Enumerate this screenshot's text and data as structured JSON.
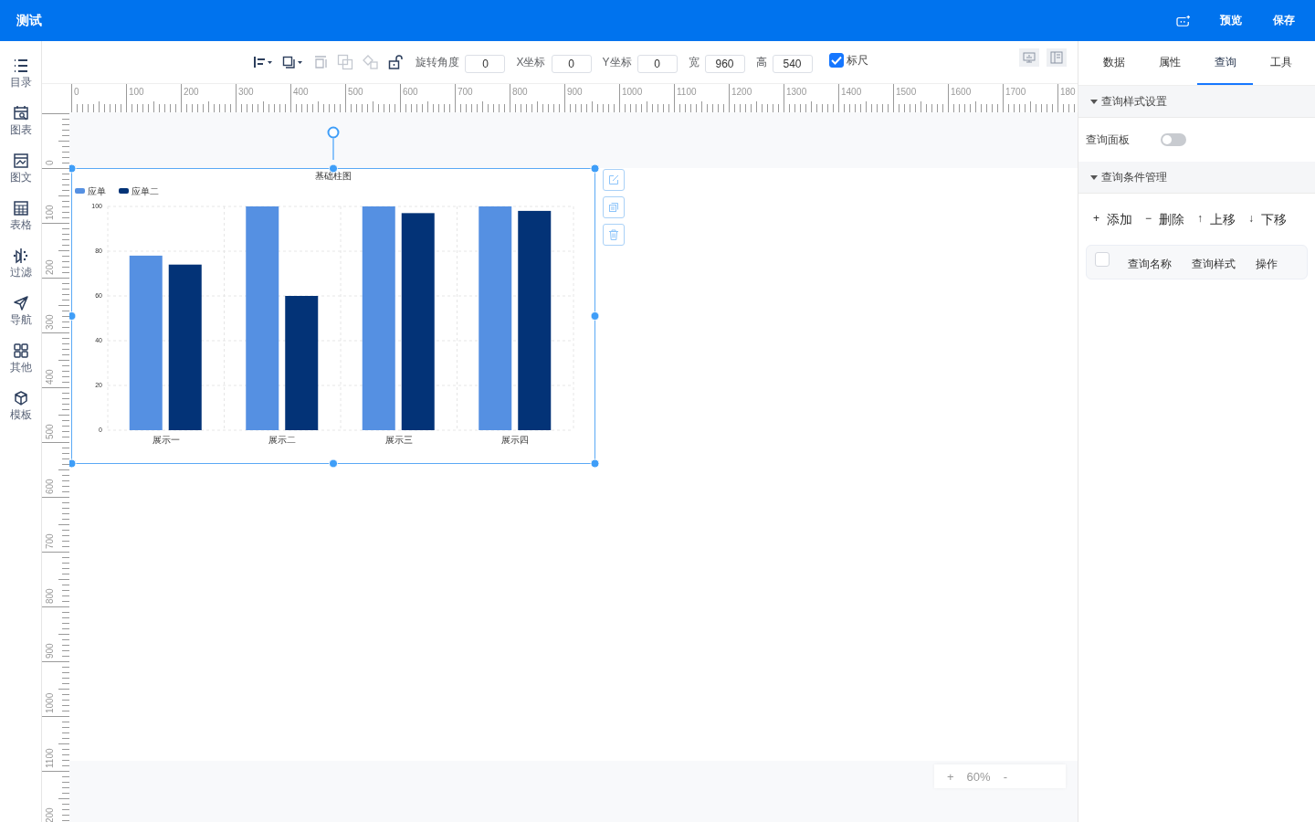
{
  "header": {
    "title": "测试",
    "actions": [
      "预览",
      "保存"
    ]
  },
  "sidebar": {
    "items": [
      {
        "label": "目录"
      },
      {
        "label": "图表"
      },
      {
        "label": "图文"
      },
      {
        "label": "表格"
      },
      {
        "label": "过滤"
      },
      {
        "label": "导航"
      },
      {
        "label": "其他"
      },
      {
        "label": "模板"
      }
    ]
  },
  "toolbar": {
    "fields": [
      {
        "label": "旋转角度",
        "value": "0"
      },
      {
        "label": "X坐标",
        "value": "0"
      },
      {
        "label": "Y坐标",
        "value": "0"
      },
      {
        "label": "宽",
        "value": "960"
      },
      {
        "label": "高",
        "value": "540"
      }
    ],
    "ruler_toggle": {
      "label": "标尺",
      "checked": true
    }
  },
  "rulers": {
    "x_labels": [
      "0",
      "100",
      "200",
      "300",
      "400",
      "500",
      "600",
      "700",
      "800",
      "900",
      "1000",
      "1100",
      "1200",
      "1300",
      "1400",
      "1500",
      "1600",
      "1700",
      "180"
    ],
    "y_labels": [
      "0",
      "100",
      "200",
      "300",
      "400",
      "500",
      "600",
      "700",
      "800",
      "900",
      "1000",
      "1100",
      "200"
    ]
  },
  "canvas": {
    "chart": {
      "selected": true,
      "chart_data": {
        "type": "bar",
        "title": "基础柱图",
        "categories": [
          "展示一",
          "展示二",
          "展示三",
          "展示四"
        ],
        "series": [
          {
            "name": "应单",
            "color": "#5590e2",
            "values": [
              78,
              100,
              100,
              100
            ]
          },
          {
            "name": "应单二",
            "color": "#033377",
            "values": [
              74,
              60,
              97,
              98
            ]
          }
        ],
        "ylim": [
          0,
          100
        ],
        "yticks": [
          {
            "value": 0,
            "label": "0"
          },
          {
            "value": 20,
            "label": "20"
          },
          {
            "value": 40,
            "label": "40"
          },
          {
            "value": 60,
            "label": "60"
          },
          {
            "value": 80,
            "label": "80"
          },
          {
            "value": 100,
            "label": "100"
          }
        ],
        "grid": true,
        "legend": true
      }
    }
  },
  "zoom": {
    "plus": "+",
    "value": "60%",
    "minus": "-"
  },
  "panel": {
    "tabs": [
      {
        "label": "数据",
        "selected": false
      },
      {
        "label": "属性",
        "selected": false
      },
      {
        "label": "查询",
        "selected": true
      },
      {
        "label": "工具",
        "selected": false
      }
    ],
    "style_section": {
      "title": "查询样式设置",
      "expanded": true,
      "toggle": {
        "label": "查询面板",
        "on": false
      }
    },
    "condition_section": {
      "title": "查询条件管理",
      "expanded": true,
      "actions": [
        {
          "icon": "+",
          "label": "添加"
        },
        {
          "icon": "−",
          "label": "删除"
        },
        {
          "icon": "↑",
          "label": "上移"
        },
        {
          "icon": "↓",
          "label": "下移"
        }
      ],
      "table": {
        "checked": false,
        "columns": [
          "查询名称",
          "查询样式",
          "操作"
        ]
      }
    }
  }
}
